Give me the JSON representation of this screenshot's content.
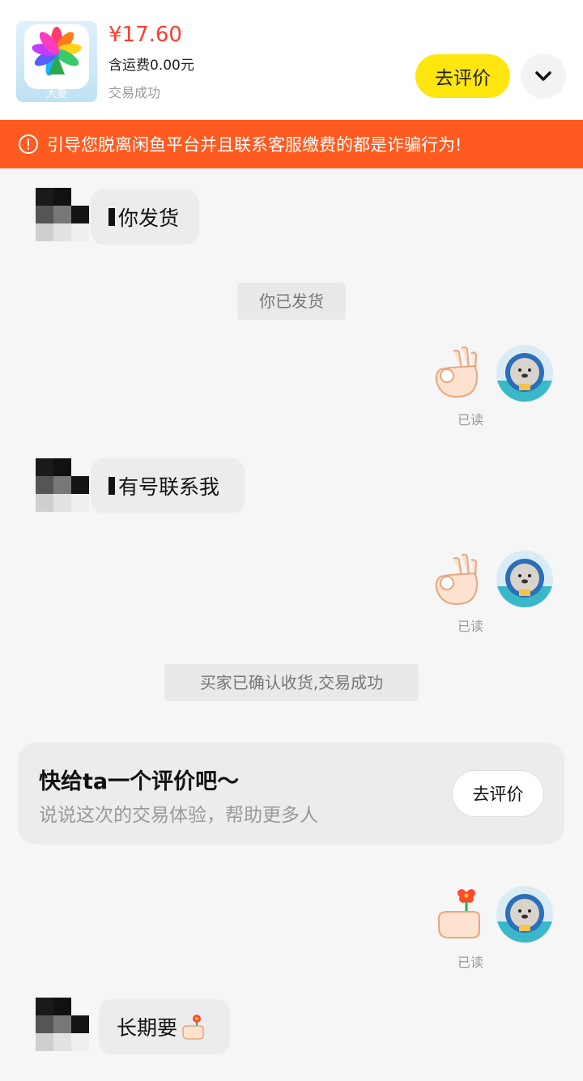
{
  "header": {
    "app_caption": "大麦",
    "price": "¥17.60",
    "shipping": "含运费0.00元",
    "status": "交易成功",
    "eval_button": "去评价",
    "expand_icon": "chevron-down-icon"
  },
  "banner": {
    "icon": "warning-circle-icon",
    "text": "引导您脱离闲鱼平台并且联系客服缴费的都是诈骗行为!"
  },
  "messages": [
    {
      "type": "incoming",
      "text": "你发货"
    },
    {
      "type": "system",
      "text": "你已发货"
    },
    {
      "type": "outgoing-sticker",
      "sticker": "ok-hand-icon",
      "read": "已读"
    },
    {
      "type": "incoming",
      "text": "有号联系我"
    },
    {
      "type": "outgoing-sticker",
      "sticker": "ok-hand-icon",
      "read": "已读"
    },
    {
      "type": "system",
      "text": "买家已确认收货,交易成功"
    },
    {
      "type": "outgoing-sticker",
      "sticker": "hand-flower-icon",
      "read": "已读"
    },
    {
      "type": "incoming",
      "text": "长期要"
    }
  ],
  "review_card": {
    "title": "快给ta一个评价吧～",
    "subtitle": "说说这次的交易体验，帮助更多人",
    "button": "去评价"
  },
  "colors": {
    "price": "#ff3b30",
    "banner": "#ff5a1f",
    "eval_button": "#ffe60f"
  }
}
